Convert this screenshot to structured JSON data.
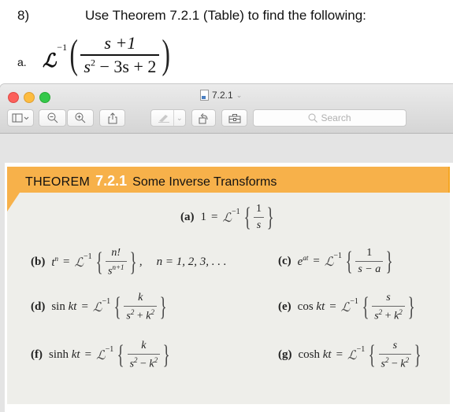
{
  "question": {
    "number": "8)",
    "instruction": "Use Theorem 7.2.1 (Table) to find the following:",
    "part_label": "a.",
    "operator": "ℒ",
    "operator_power": "−1",
    "numerator": "s +1",
    "denominator_base": "s",
    "denominator_exp": "2",
    "denominator_rest": " − 3s + 2"
  },
  "window": {
    "title": "7.2.1",
    "toolbar": {
      "sidebar_button": "sidebar-toggle",
      "zoom_out": "zoom-out",
      "zoom_in": "zoom-in",
      "share": "share",
      "markup": "markup",
      "rotate": "rotate-left",
      "toolbox": "toolbox"
    },
    "search_placeholder": "Search"
  },
  "theorem": {
    "word": "THEOREM",
    "number": "7.2.1",
    "title": "Some Inverse Transforms",
    "operator": "ℒ",
    "inv": "−1",
    "items": [
      {
        "label": "(a)",
        "lhs": "1",
        "num": "1",
        "den": "s",
        "tail": ""
      },
      {
        "label": "(b)",
        "lhs_base": "t",
        "lhs_exp": "n",
        "num": "n!",
        "den_base": "s",
        "den_exp": "n+1",
        "tail": "n = 1, 2, 3, . . ."
      },
      {
        "label": "(c)",
        "lhs_base": "e",
        "lhs_exp": "at",
        "num": "1",
        "den": "s − a"
      },
      {
        "label": "(d)",
        "lhs_fn": "sin",
        "lhs_arg": "kt",
        "num": "k",
        "den_a": "s",
        "den_op": " + ",
        "den_b": "k"
      },
      {
        "label": "(e)",
        "lhs_fn": "cos",
        "lhs_arg": "kt",
        "num": "s",
        "den_a": "s",
        "den_op": " + ",
        "den_b": "k"
      },
      {
        "label": "(f)",
        "lhs_fn": "sinh",
        "lhs_arg": "kt",
        "num": "k",
        "den_a": "s",
        "den_op": " − ",
        "den_b": "k"
      },
      {
        "label": "(g)",
        "lhs_fn": "cosh",
        "lhs_arg": "kt",
        "num": "s",
        "den_a": "s",
        "den_op": " − ",
        "den_b": "k"
      }
    ],
    "square": "2",
    "equals": "=",
    "comma": ","
  },
  "colors": {
    "theorem_header": "#f7b14a",
    "theorem_body": "#eeeeea",
    "traffic_red": "#fc605b",
    "traffic_yellow": "#fdbc40",
    "traffic_green": "#34c84a"
  }
}
